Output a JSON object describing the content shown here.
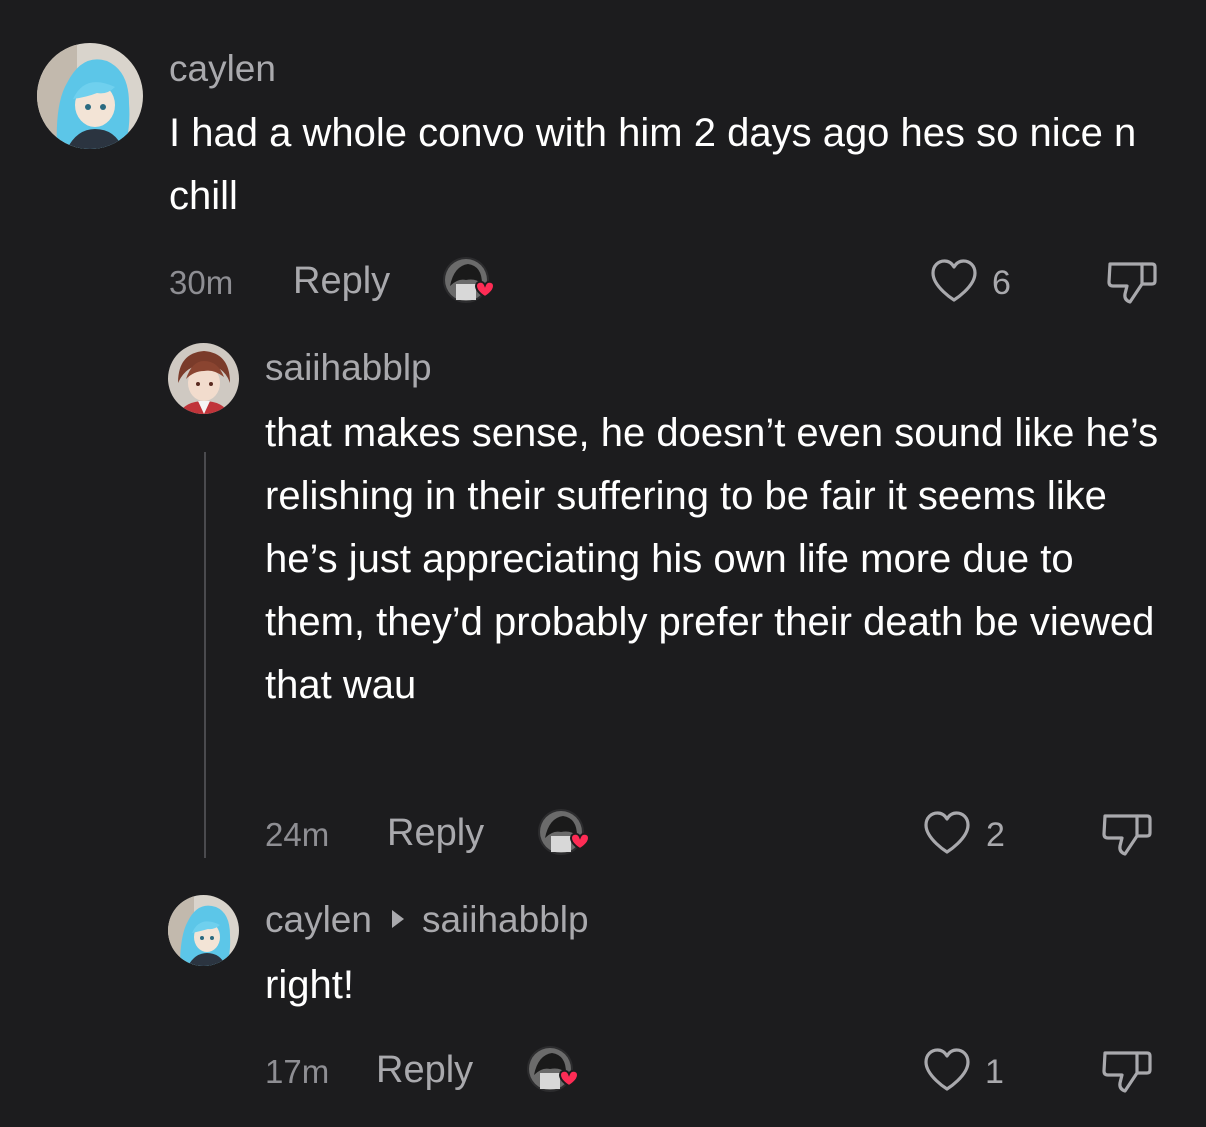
{
  "comments": [
    {
      "username": "caylen",
      "text": "I had a whole convo with him 2 days ago hes so nice n chill",
      "time": "30m",
      "reply_label": "Reply",
      "likes": "6"
    },
    {
      "username": "saiihabblp",
      "text": "that makes sense, he doesn’t even sound like he’s relishing in their suffering to be fair it seems like he’s just appreciating his own life more due to them, they’d probably prefer their death be viewed that wau",
      "time": "24m",
      "reply_label": "Reply",
      "likes": "2"
    },
    {
      "username": "caylen",
      "reply_to": "saiihabblp",
      "text": "right!",
      "time": "17m",
      "reply_label": "Reply",
      "likes": "1"
    }
  ],
  "colors": {
    "background": "#1c1c1e",
    "text_primary": "#ffffff",
    "text_secondary": "#a9a9ad",
    "heart_badge": "#fe2c55"
  },
  "icons": {
    "like": "heart-outline-icon",
    "dislike": "thumbs-down-icon",
    "creator_liked": "creator-liked-badge-icon"
  }
}
